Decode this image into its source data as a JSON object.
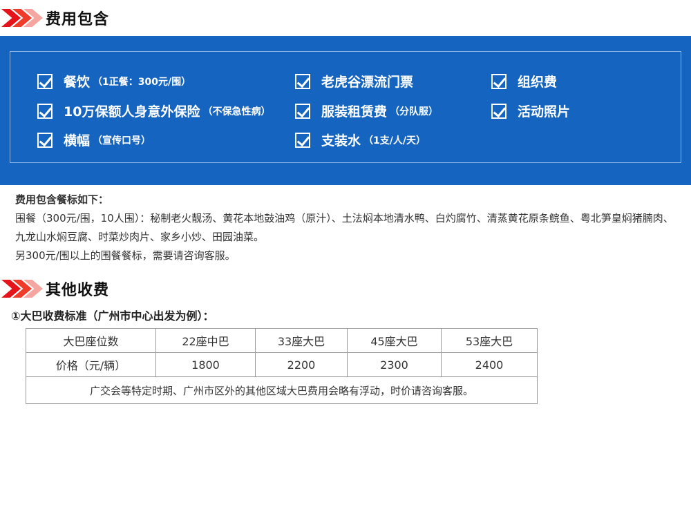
{
  "section1": {
    "title": "费用包含"
  },
  "included": [
    {
      "label": "餐饮",
      "note": "（1正餐：300元/围）"
    },
    {
      "label": "老虎谷漂流门票",
      "note": ""
    },
    {
      "label": "组织费",
      "note": ""
    },
    {
      "label": "10万保额人身意外保险",
      "note": "（不保急性病）"
    },
    {
      "label": "服装租赁费",
      "note": "（分队服）"
    },
    {
      "label": "活动照片",
      "note": ""
    },
    {
      "label": "横幅",
      "note": "（宣传口号）"
    },
    {
      "label": "支装水",
      "note": "（1支/人/天）"
    }
  ],
  "meal": {
    "title": "费用包含餐标如下：",
    "line1": "围餐（300元/围，10人围）：秘制老火靓汤、黄花本地鼓油鸡（原汁）、土法焖本地清水鸭、白灼腐竹、清蒸黄花原条鲩鱼、粤北笋皇焖猪腩肉、九龙山水焖豆腐、时菜炒肉片、家乡小炒、田园油菜。",
    "line2": "另300元/围以上的围餐餐标，需要请咨询客服。"
  },
  "section2": {
    "title": "其他收费"
  },
  "bus": {
    "title": "①大巴收费标准（广州市中心出发为例）：",
    "headers": [
      "大巴座位数",
      "22座中巴",
      "33座大巴",
      "45座大巴",
      "53座大巴"
    ],
    "row_label": "价格（元/辆）",
    "prices": [
      "1800",
      "2200",
      "2300",
      "2400"
    ],
    "note": "广交会等特定时期、广州市区外的其他区域大巴费用会略有浮动，时价请咨询客服。"
  }
}
